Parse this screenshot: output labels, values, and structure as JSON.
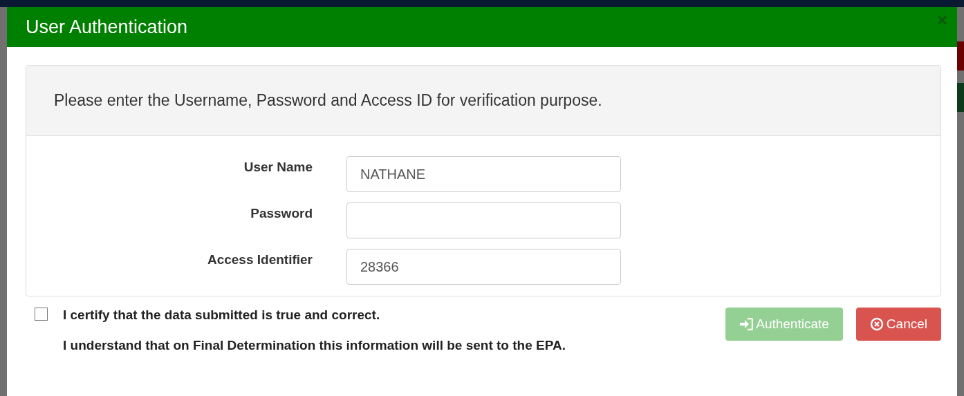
{
  "dialog": {
    "title": "User Authentication",
    "close": "×"
  },
  "instructions": "Please enter the Username, Password and Access ID for verification purpose.",
  "fields": [
    {
      "label": "User Name",
      "value": "NATHANE"
    },
    {
      "label": "Password"
    },
    {
      "label": "Access Identifier",
      "value": "28366"
    }
  ],
  "certify": {
    "checked": false,
    "text": "I certify that the data submitted is true and correct."
  },
  "notice": "I understand that on Final Determination this information will be sent to the EPA.",
  "buttons": [
    {
      "kind": "authenticate",
      "label": "Authenticate",
      "disabled": true
    },
    {
      "kind": "cancel",
      "label": "Cancel",
      "disabled": false
    }
  ]
}
